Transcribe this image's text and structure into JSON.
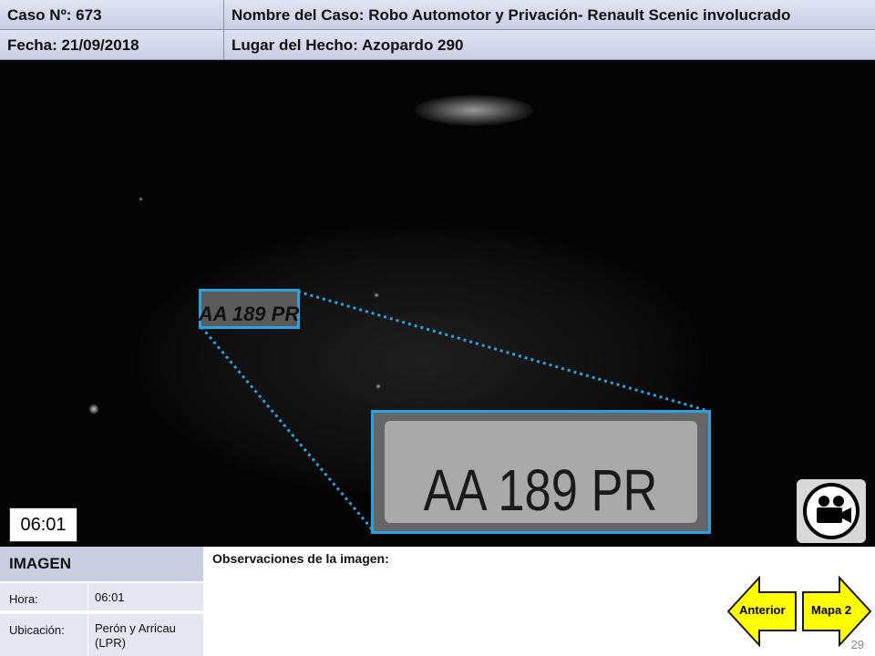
{
  "header": {
    "case_no": "Caso Nº: 673",
    "case_name": "Nombre del Caso: Robo Automotor y Privación- Renault Scenic involucrado",
    "date": "Fecha: 21/09/2018",
    "place": "Lugar del Hecho: Azopardo 290"
  },
  "image": {
    "plate_small": "AA 189 PR",
    "plate_large": "AA 189 PR",
    "timestamp": "06:01",
    "camera_icon": "video-camera-icon"
  },
  "info": {
    "title": "IMAGEN",
    "rows": [
      {
        "label": "Hora:",
        "value": "06:01"
      },
      {
        "label": "Ubicación:",
        "value": "Perón y Arricau (LPR)"
      }
    ]
  },
  "observations": {
    "label": "Observaciones de la imagen:"
  },
  "nav": {
    "prev_label": "Anterior",
    "next_label": "Mapa 2",
    "arrow_color": "#ffff00"
  },
  "page": {
    "number": "29"
  },
  "colors": {
    "header_bg": "#c9cfe4",
    "highlight_border": "#29a3e0"
  }
}
